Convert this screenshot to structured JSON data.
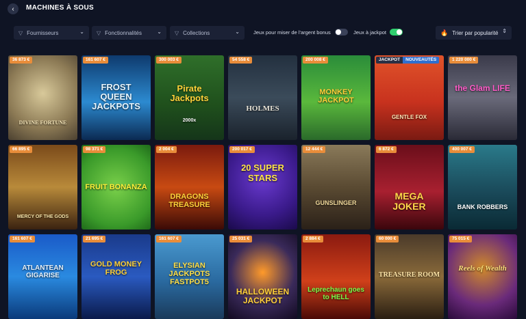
{
  "header": {
    "title": "MACHINES À SOUS",
    "back_icon": "chevron-left-icon"
  },
  "filters": {
    "providers": "Fournisseurs",
    "features": "Fonctionnalités",
    "collections": "Collections",
    "bonus_toggle_label": "Jeux pour miser de l'argent bonus",
    "bonus_toggle_on": false,
    "jackpot_toggle_label": "Jeux à jackpot",
    "jackpot_toggle_on": true,
    "sort_label": "Trier par popularité"
  },
  "colors": {
    "background": "#0f1424",
    "badge": "#e98d3a",
    "toggle_on": "#2fce6e",
    "toggle_off": "#3a4158",
    "new_badge": "#2f6fcf"
  },
  "games": [
    {
      "badge": "36 873 €",
      "title": "DIVINE FORTUNE",
      "theme": "gold-pegasus"
    },
    {
      "badge": "161 607 €",
      "title": "FROST QUEEN JACKPOTS",
      "theme": "ice"
    },
    {
      "badge": "300 003 €",
      "title": "Pirate Jackpots",
      "subtitle": "2000x",
      "theme": "jungle"
    },
    {
      "badge": "54 558 €",
      "title": "HOLMES",
      "theme": "dark-detective"
    },
    {
      "badge": "200 008 €",
      "title": "MONKEY JACKPOT",
      "theme": "green"
    },
    {
      "badge": "JACKPOT",
      "badge_extra": "NOUVEAUTÉS",
      "title": "GENTLE FOX",
      "theme": "red"
    },
    {
      "badge": "1 220 000 €",
      "title": "the Glam LIFE",
      "theme": "pink"
    },
    {
      "badge": "66 895 €",
      "title": "MERCY OF THE GODS",
      "theme": "bronze"
    },
    {
      "badge": "98 371 €",
      "title": "FRUIT BONANZA",
      "theme": "fruit"
    },
    {
      "badge": "2 004 €",
      "title": "DRAGONS TREASURE",
      "theme": "dragon"
    },
    {
      "badge": "200 017 €",
      "title": "20 SUPER STARS",
      "theme": "purple-stars"
    },
    {
      "badge": "12 444 €",
      "title": "GUNSLINGER",
      "theme": "western"
    },
    {
      "badge": "6 872 €",
      "title": "MEGA JOKER",
      "theme": "joker"
    },
    {
      "badge": "400 007 €",
      "title": "BANK ROBBERS",
      "theme": "teal"
    },
    {
      "badge": "161 607 €",
      "title": "ATLANTEAN GIGARISE",
      "theme": "ocean"
    },
    {
      "badge": "21 695 €",
      "title": "GOLD MONEY FROG",
      "theme": "frog"
    },
    {
      "badge": "161 607 €",
      "title": "ELYSIAN JACKPOTS FASTPOT5",
      "theme": "sky"
    },
    {
      "badge": "25 031 €",
      "title": "HALLOWEEN JACKPOT",
      "theme": "halloween"
    },
    {
      "badge": "2 884 €",
      "title": "Leprechaun goes to HELL",
      "theme": "hell"
    },
    {
      "badge": "60 000 €",
      "title": "TREASURE ROOM",
      "theme": "temple"
    },
    {
      "badge": "75 015 €",
      "title": "Reels of Wealth",
      "theme": "wealth"
    }
  ]
}
